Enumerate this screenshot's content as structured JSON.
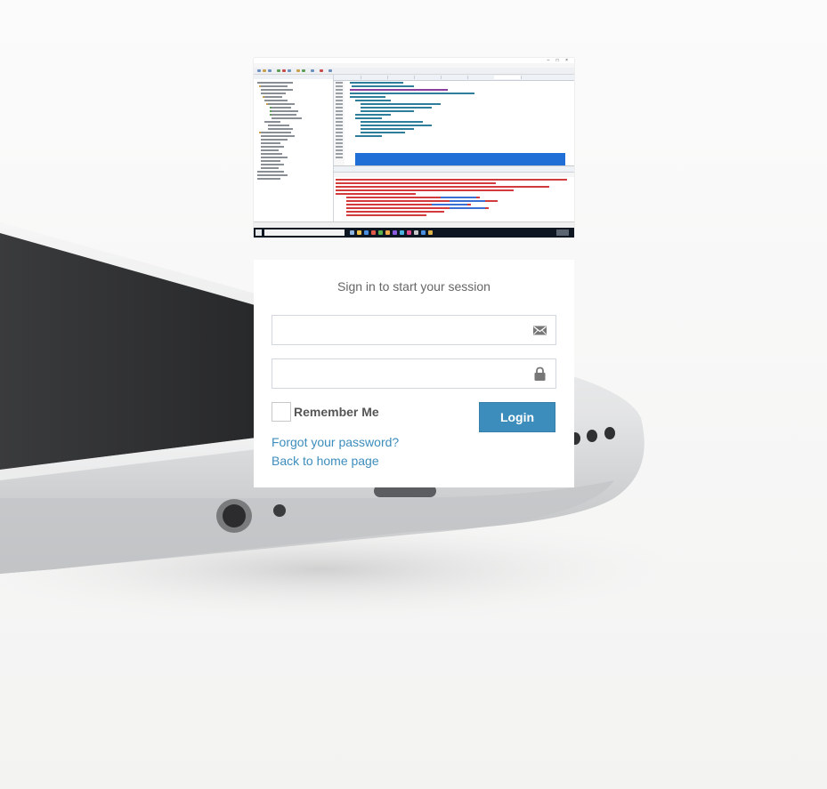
{
  "login": {
    "message": "Sign in to start your session",
    "email": {
      "value": "",
      "placeholder": "",
      "icon": "envelope-icon"
    },
    "password": {
      "value": "",
      "placeholder": "",
      "icon": "lock-icon"
    },
    "remember_label": "Remember Me",
    "remember_checked": false,
    "login_label": "Login",
    "forgot_link": "Forgot your password?",
    "home_link": "Back to home page"
  },
  "colors": {
    "primary": "#3c8dbc",
    "link": "#3c8dbc",
    "text_muted": "#666666",
    "border": "#d2d6de",
    "page_background": "#f4f4f3"
  },
  "logo": {
    "kind": "screenshot of IDE with pom.xml editor and console output"
  }
}
